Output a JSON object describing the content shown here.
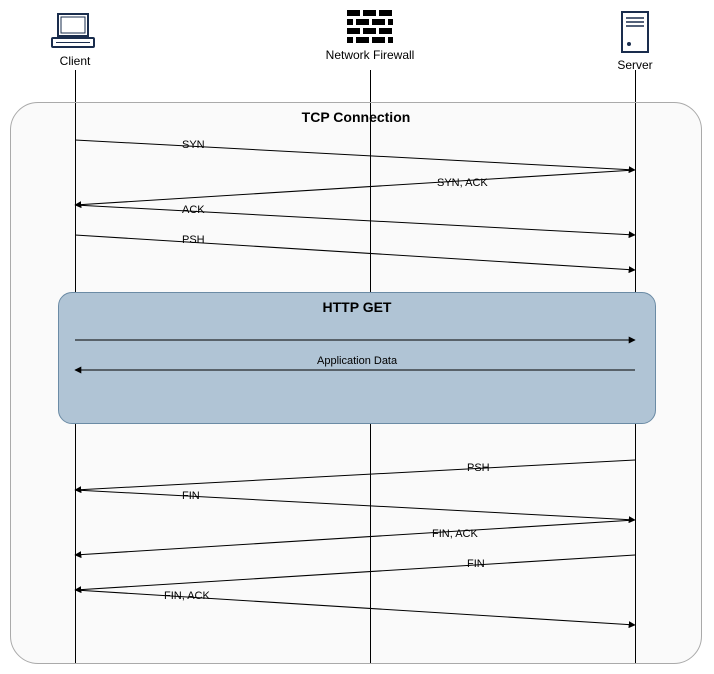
{
  "actors": {
    "client": {
      "label": "Client"
    },
    "firewall": {
      "label": "Network Firewall"
    },
    "server": {
      "label": "Server"
    }
  },
  "frames": {
    "tcp": {
      "title": "TCP Connection"
    },
    "http": {
      "title": "HTTP GET"
    }
  },
  "messages": {
    "syn": "SYN",
    "syn_ack": "SYN, ACK",
    "ack": "ACK",
    "psh1": "PSH",
    "app_data": "Application Data",
    "psh2": "PSH",
    "fin1": "FIN",
    "fin_ack1": "FIN, ACK",
    "fin2": "FIN",
    "fin_ack2": "FIN, ACK"
  }
}
